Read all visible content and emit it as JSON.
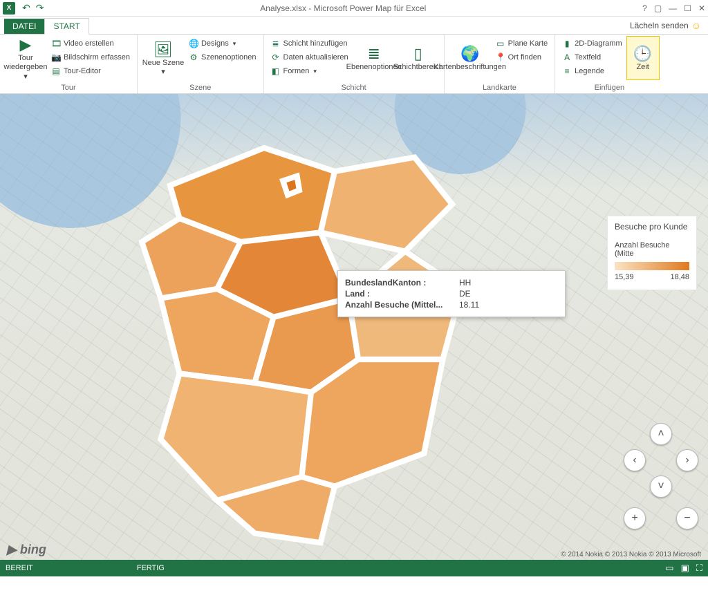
{
  "titlebar": {
    "title": "Analyse.xlsx - Microsoft Power Map für Excel"
  },
  "tabs": {
    "file": "DATEI",
    "start": "START",
    "feedback": "Lächeln senden"
  },
  "ribbon": {
    "tour": {
      "play": "Tour wiedergeben",
      "video": "Video erstellen",
      "screen": "Bildschirm erfassen",
      "editor": "Tour-Editor",
      "label": "Tour"
    },
    "scene": {
      "new": "Neue Szene",
      "designs": "Designs",
      "options": "Szenenoptionen",
      "label": "Szene"
    },
    "layer": {
      "add": "Schicht hinzufügen",
      "refresh": "Daten aktualisieren",
      "shapes": "Formen",
      "layeropts": "Ebenenoptionen",
      "layerpane": "Schichtbereich",
      "label": "Schicht"
    },
    "map": {
      "labels": "Kartenbeschriftungen",
      "flat": "Plane Karte",
      "find": "Ort finden",
      "label": "Landkarte"
    },
    "insert": {
      "chart": "2D-Diagramm",
      "text": "Textfeld",
      "legend": "Legende",
      "time": "Zeit",
      "label": "Einfügen"
    }
  },
  "tooltip": {
    "k1": "BundeslandKanton :",
    "v1": "HH",
    "k2": "Land :",
    "v2": "DE",
    "k3": "Anzahl Besuche (Mittel...",
    "v3": "18.11"
  },
  "legend": {
    "title": "Besuche pro Kunde",
    "measure": "Anzahl Besuche (Mitte",
    "min": "15,39",
    "max": "18,48"
  },
  "map": {
    "bing": "▶ bing",
    "credits": "© 2014 Nokia  © 2013 Nokia  © 2013 Microsoft"
  },
  "status": {
    "ready": "BEREIT",
    "done": "FERTIG"
  },
  "chart_data": {
    "type": "choropleth-map",
    "title": "Besuche pro Kunde",
    "measure": "Anzahl Besuche (Mittelwert)",
    "geography_level": "BundeslandKanton",
    "country": "DE",
    "value_range": [
      15.39,
      18.48
    ],
    "highlighted_region": {
      "BundeslandKanton": "HH",
      "Land": "DE",
      "value": 18.11
    }
  }
}
